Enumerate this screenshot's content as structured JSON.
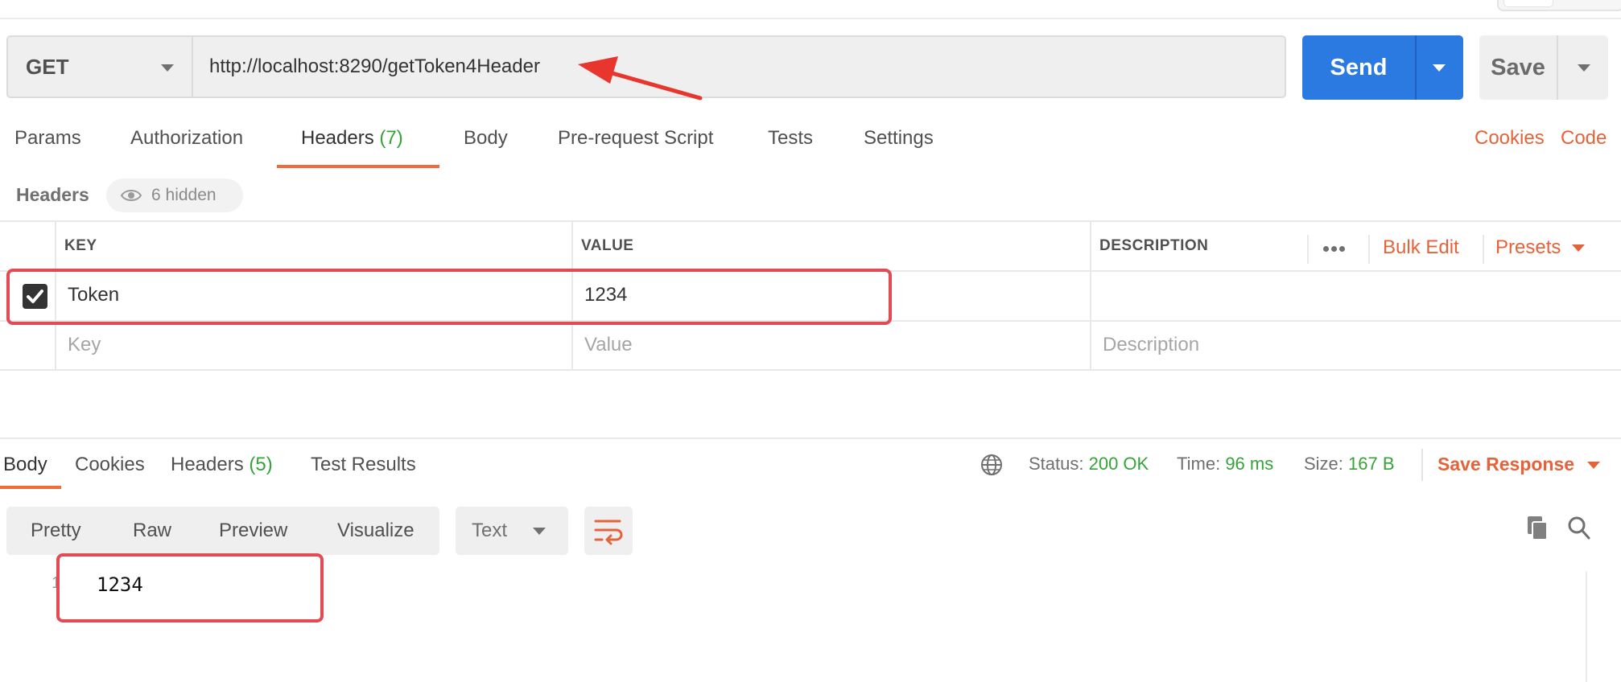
{
  "request": {
    "method": "GET",
    "url": "http://localhost:8290/getToken4Header",
    "send_label": "Send",
    "save_label": "Save"
  },
  "tabs": [
    {
      "label": "Params"
    },
    {
      "label": "Authorization"
    },
    {
      "label": "Headers",
      "count": "(7)"
    },
    {
      "label": "Body"
    },
    {
      "label": "Pre-request Script"
    },
    {
      "label": "Tests"
    },
    {
      "label": "Settings"
    }
  ],
  "links": {
    "cookies": "Cookies",
    "code": "Code"
  },
  "headers_section": {
    "label": "Headers",
    "hidden": "6 hidden"
  },
  "table": {
    "columns": {
      "key": "KEY",
      "value": "VALUE",
      "description": "DESCRIPTION"
    },
    "bulk_edit": "Bulk Edit",
    "presets": "Presets",
    "rows": [
      {
        "checked": true,
        "key": "Token",
        "value": "1234",
        "description": ""
      }
    ],
    "placeholders": {
      "key": "Key",
      "value": "Value",
      "description": "Description"
    }
  },
  "response": {
    "tabs": [
      {
        "label": "Body"
      },
      {
        "label": "Cookies"
      },
      {
        "label": "Headers",
        "count": "(5)"
      },
      {
        "label": "Test Results"
      }
    ],
    "status_label": "Status:",
    "status_value": "200 OK",
    "time_label": "Time:",
    "time_value": "96 ms",
    "size_label": "Size:",
    "size_value": "167 B",
    "save_response": "Save Response",
    "formats": [
      "Pretty",
      "Raw",
      "Preview",
      "Visualize"
    ],
    "format_type": "Text",
    "lines": [
      {
        "number": "1",
        "text": "1234"
      }
    ]
  },
  "colors": {
    "accent": "#f26b3a",
    "send": "#2a7ae2",
    "status_ok": "#36a33a",
    "annotation_red": "#e34a53"
  }
}
